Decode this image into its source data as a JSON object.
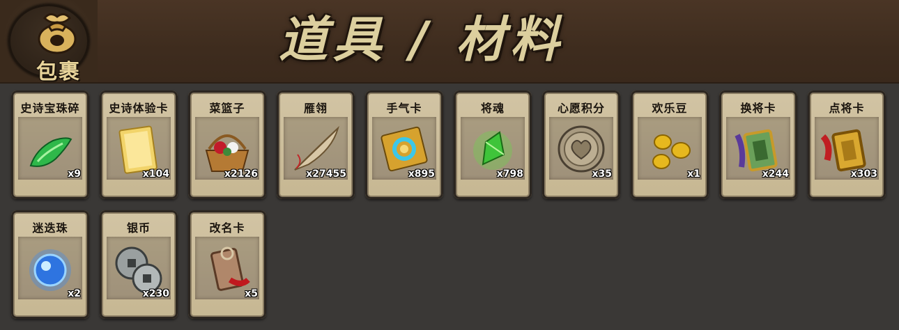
{
  "header": {
    "bag_label": "包裹",
    "title": "道具 / 材料"
  },
  "items": [
    {
      "name": "史诗宝珠碎",
      "count": "x9",
      "icon": "green-gem-shard-icon"
    },
    {
      "name": "史诗体验卡",
      "count": "x104",
      "icon": "golden-card-icon"
    },
    {
      "name": "菜篮子",
      "count": "x2126",
      "icon": "flower-basket-icon"
    },
    {
      "name": "雁翎",
      "count": "x27455",
      "icon": "feather-icon"
    },
    {
      "name": "手气卡",
      "count": "x895",
      "icon": "luck-card-icon"
    },
    {
      "name": "将魂",
      "count": "x798",
      "icon": "green-crystal-icon"
    },
    {
      "name": "心愿积分",
      "count": "x35",
      "icon": "heart-coin-icon"
    },
    {
      "name": "欢乐豆",
      "count": "x1",
      "icon": "golden-beans-icon"
    },
    {
      "name": "换将卡",
      "count": "x244",
      "icon": "swap-general-token-icon"
    },
    {
      "name": "点将卡",
      "count": "x303",
      "icon": "pick-general-token-icon"
    },
    {
      "name": "迷迭珠",
      "count": "x2",
      "icon": "blue-orb-icon"
    },
    {
      "name": "银币",
      "count": "x230",
      "icon": "silver-coins-icon"
    },
    {
      "name": "改名卡",
      "count": "x5",
      "icon": "rename-card-icon"
    }
  ],
  "colors": {
    "header_bg": "#3e2c1e",
    "body_bg": "#3a3836",
    "card_bg": "#c6b792",
    "title_text": "#dccf9e"
  }
}
